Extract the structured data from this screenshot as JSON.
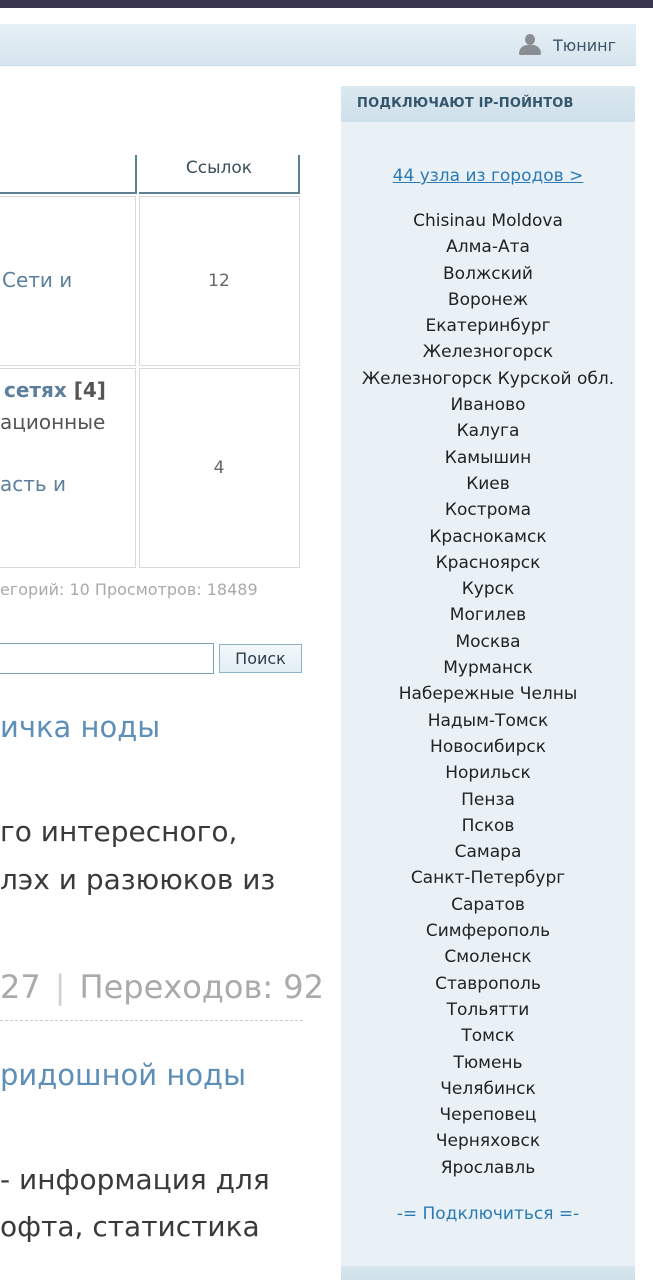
{
  "header": {
    "tuning_label": "Тюнинг"
  },
  "table": {
    "column_header": "Ссылок",
    "rows": [
      {
        "line1": "Сети и",
        "count": "12"
      },
      {
        "title": "сетях",
        "title_count": "[4]",
        "line2": "ационные",
        "line3": "асть и",
        "count": "4"
      }
    ],
    "stats": "егорий: 10   Просмотров: 18489"
  },
  "search": {
    "button_label": "Поиск",
    "value": ""
  },
  "articles": [
    {
      "title": "ичка ноды",
      "text_line1": "го интересного,",
      "text_line2": "лэх и разююков из"
    },
    {
      "title": "ридошной ноды",
      "text_line1": "- информация для",
      "text_line2": "офта, статистика"
    }
  ],
  "meta": {
    "views_partial": "27",
    "separator": "|",
    "transitions": "Переходов: 92"
  },
  "sidebar": {
    "header": "ПОДКЛЮЧАЮТ IP-ПОЙНТОВ",
    "nodes_link": "44 узла из городов >",
    "cities": [
      "Chisinau Moldova",
      "Алма-Ата",
      "Волжский",
      "Воронеж",
      "Екатеринбург",
      "Железногорск",
      "Железногорск Курской обл.",
      "Иваново",
      "Калуга",
      "Камышин",
      "Киев",
      "Кострома",
      "Краснокамск",
      "Красноярск",
      "Курск",
      "Могилев",
      "Москва",
      "Мурманск",
      "Набережные Челны",
      "Надым-Томск",
      "Новосибирск",
      "Норильск",
      "Пенза",
      "Псков",
      "Самара",
      "Санкт-Петербург",
      "Саратов",
      "Симферополь",
      "Смоленск",
      "Ставрополь",
      "Тольятти",
      "Томск",
      "Тюмень",
      "Челябинск",
      "Череповец",
      "Черняховск",
      "Ярославль"
    ],
    "connect_label": "-= Подключиться =-"
  }
}
